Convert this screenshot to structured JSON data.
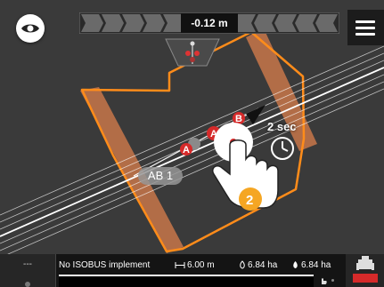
{
  "lightbar": {
    "offset": "-0.12 m"
  },
  "map": {
    "ab_line_label": "AB 1",
    "point_a": "A",
    "point_b": "B",
    "hold_duration": "2 sec",
    "step_number": "2"
  },
  "status_bar": {
    "left_label": "---",
    "implement": "No ISOBUS implement",
    "working_width": "6.00 m",
    "area_worked": "6.84 ha",
    "area_total": "6.84 ha"
  },
  "icons": {
    "visibility": "eye-icon",
    "menu": "hamburger-menu-icon",
    "hold_gesture": "hand-tap-icon",
    "timer": "clock-icon",
    "machine": "tractor-implement-icon"
  },
  "colors": {
    "map_background": "#3a3a3a",
    "boundary": "#ff8c1a",
    "headland": "#c8774a",
    "guidance_lines": "#ffffff",
    "point_red": "#d62a2a",
    "step_badge": "#f5a623"
  }
}
